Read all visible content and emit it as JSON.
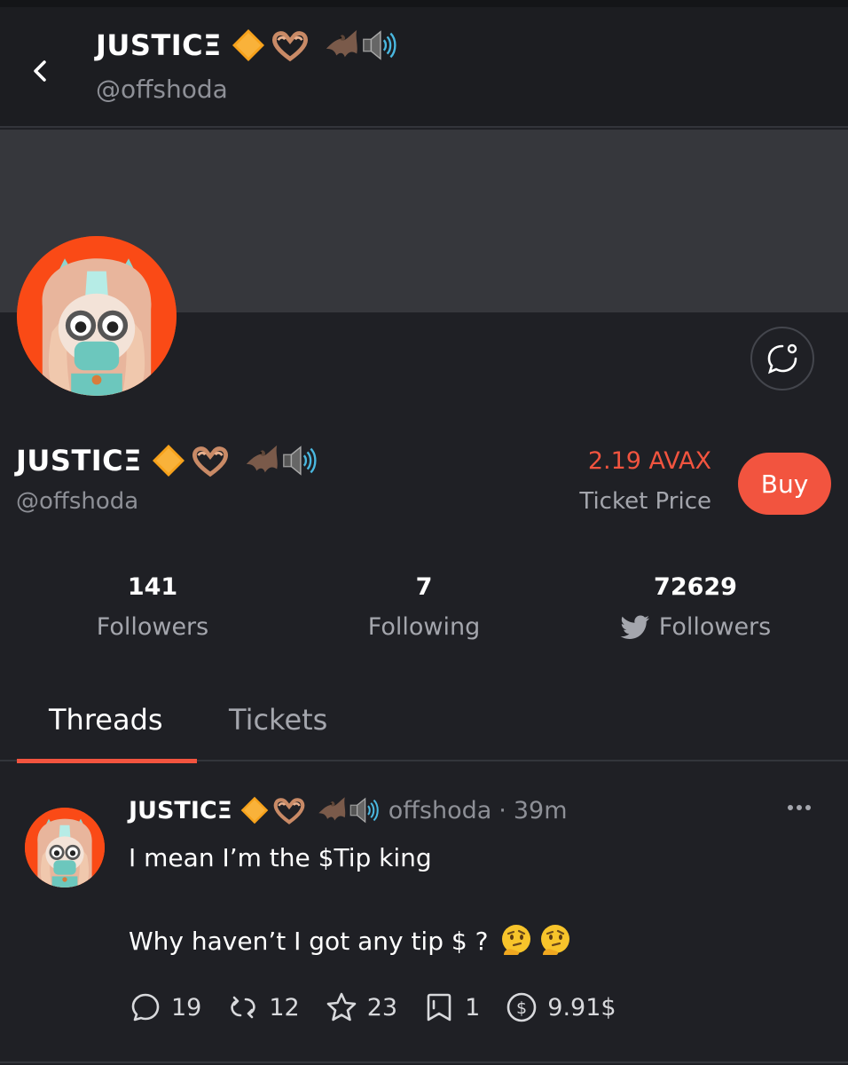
{
  "header": {
    "back_icon": "chevron-left-icon",
    "name": "JUSTICΞ",
    "handle": "@offshoda"
  },
  "profile": {
    "name": "JUSTICΞ",
    "handle": "@offshoda",
    "name_emojis": [
      "orange-diamond-icon",
      "heart-hands-icon",
      "bat-icon",
      "speaker-icon"
    ],
    "ticket_price": "2.19 AVAX",
    "ticket_price_label": "Ticket Price",
    "buy_label": "Buy",
    "message_icon": "chat-bubble-icon"
  },
  "stats": [
    {
      "value": "141",
      "label": "Followers"
    },
    {
      "value": "7",
      "label": "Following"
    },
    {
      "value": "72629",
      "label": "Followers",
      "icon": "twitter-bird-icon"
    }
  ],
  "tabs": [
    {
      "label": "Threads",
      "active": true
    },
    {
      "label": "Tickets",
      "active": false
    }
  ],
  "post": {
    "author_name": "JUSTICΞ",
    "author_handle": "offshoda",
    "separator": "·",
    "time": "39m",
    "line1": "I mean I’m the $Tip king",
    "line2": "Why haven’t I got any tip $ ?",
    "emojis": [
      "thinking-face-icon",
      "thinking-face-icon"
    ],
    "actions": {
      "replies": "19",
      "reposts": "12",
      "likes": "23",
      "bookmarks": "1",
      "tips": "9.91$"
    }
  },
  "colors": {
    "background": "#1f2025",
    "accent": "#f2543f",
    "muted_text": "#a4a6ad",
    "banner": "#36373c"
  }
}
